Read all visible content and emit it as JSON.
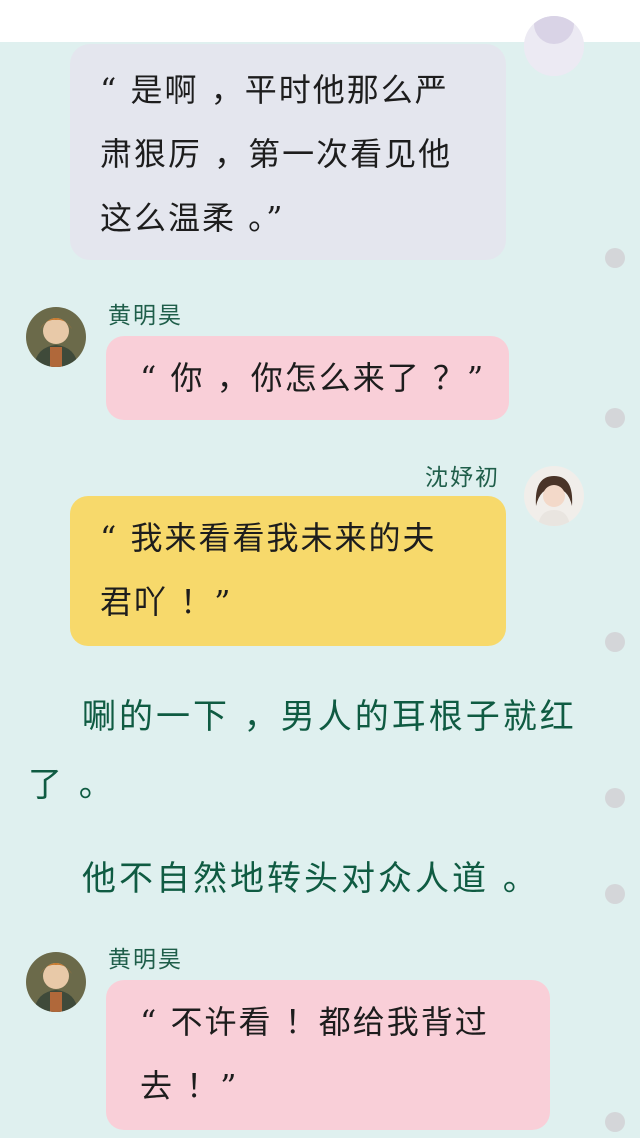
{
  "messages": [
    {
      "type": "other_cont",
      "text_lines": [
        "“ 是啊 ，平时他那么严",
        "肃狠厉 ，第一次看见他",
        "这么温柔 。”"
      ]
    },
    {
      "type": "left",
      "name": "黄明昊",
      "text": "“ 你 ，你怎么来了 ？”"
    },
    {
      "type": "right",
      "name": "沈妤初",
      "text_lines": [
        "“ 我来看看我未来的夫",
        "君吖 ！”"
      ]
    }
  ],
  "narration": {
    "line1": "唰的一下 ，男人的耳根子就红",
    "line2": "了 。",
    "line3": "他不自然地转头对众人道 。"
  },
  "last_message": {
    "name": "黄明昊",
    "text_lines": [
      "“ 不许看 ！都给我背过",
      "去 ！”"
    ]
  },
  "colors": {
    "background": "#dff0ef",
    "gray_bubble": "#e4e6ee",
    "pink_bubble": "#f9cfd8",
    "yellow_bubble": "#f7d96b",
    "narration_text": "#0f5b42",
    "name_text": "#1f5e4a"
  },
  "icons": {
    "avatar_male": "avatar-huang-minghao",
    "avatar_female": "avatar-shen-yuchu",
    "avatar_top_partial": "avatar-partial"
  }
}
